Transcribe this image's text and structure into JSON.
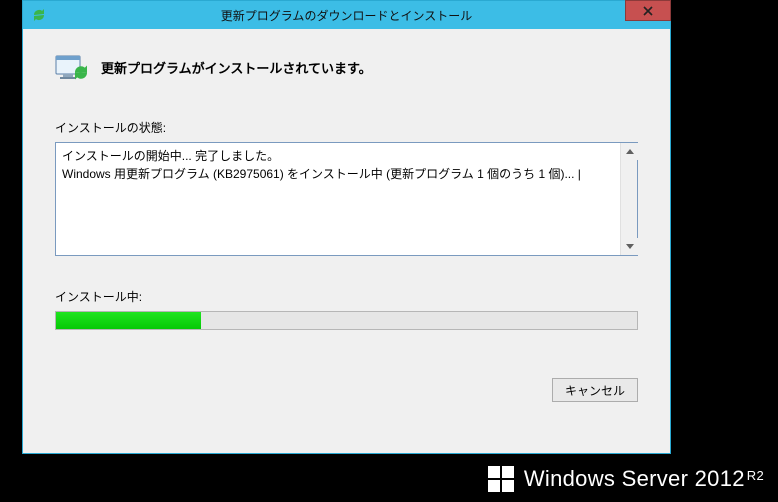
{
  "window": {
    "title": "更新プログラムのダウンロードとインストール",
    "close_tooltip": "閉じる"
  },
  "header": {
    "text": "更新プログラムがインストールされています。"
  },
  "status": {
    "label": "インストールの状態:",
    "log": "インストールの開始中... 完了しました。\nWindows 用更新プログラム (KB2975061) をインストール中 (更新プログラム 1 個のうち 1 個)... |"
  },
  "progress": {
    "label": "インストール中:",
    "percent": 25
  },
  "buttons": {
    "cancel": "キャンセル"
  },
  "watermark": {
    "product": "Windows Server 2012",
    "suffix": "R2"
  }
}
